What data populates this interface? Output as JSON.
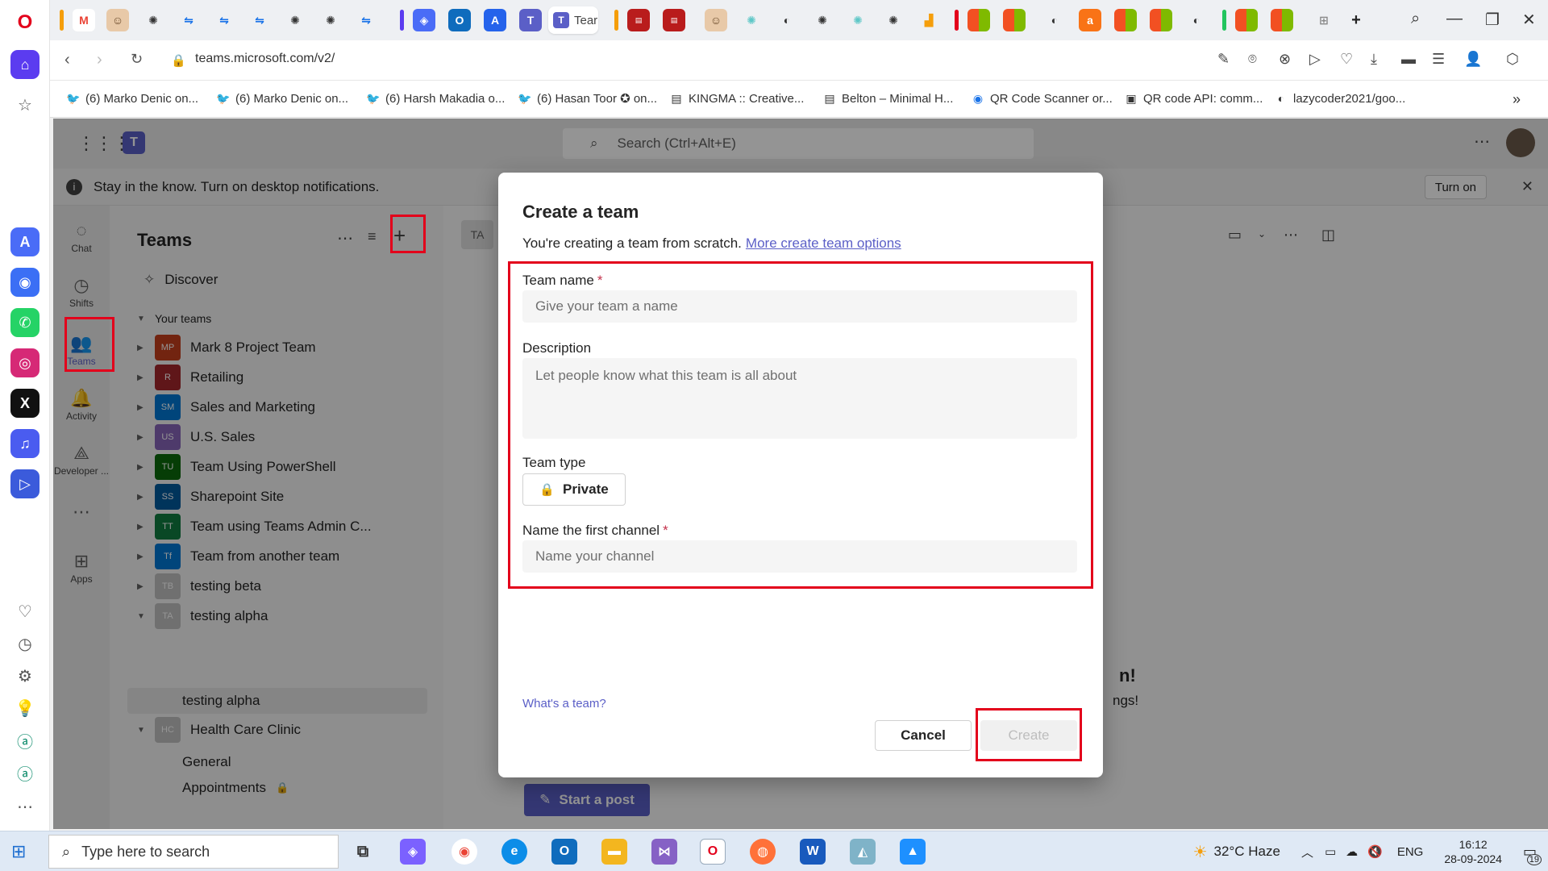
{
  "browser": {
    "url": "teams.microsoft.com/v2/",
    "active_tab_label": "Tear",
    "bookmarks": [
      "(6) Marko Denic on...",
      "(6) Marko Denic on...",
      "(6) Harsh Makadia o...",
      "(6) Hasan Toor ✪ on...",
      "KINGMA :: Creative...",
      "Belton – Minimal H...",
      "QR Code Scanner or...",
      "QR code API: comm...",
      "lazycoder2021/goo..."
    ]
  },
  "teams": {
    "search_placeholder": "Search (Ctrl+Alt+E)",
    "notification_text": "Stay in the know. Turn on desktop notifications.",
    "turn_on_label": "Turn on",
    "rail": {
      "chat": "Chat",
      "shifts": "Shifts",
      "teams": "Teams",
      "activity": "Activity",
      "developer": "Developer ...",
      "apps": "Apps"
    },
    "panel_title": "Teams",
    "discover_label": "Discover",
    "your_teams_label": "Your teams",
    "list": [
      {
        "initials": "MP",
        "name": "Mark 8 Project Team",
        "color": "#c43e1c"
      },
      {
        "initials": "R",
        "name": "Retailing",
        "color": "#a4262c"
      },
      {
        "initials": "SM",
        "name": "Sales and Marketing",
        "color": "#0078d4"
      },
      {
        "initials": "US",
        "name": "U.S. Sales",
        "color": "#8764b8"
      },
      {
        "initials": "TU",
        "name": "Team Using PowerShell",
        "color": "#0b6a0b"
      },
      {
        "initials": "SS",
        "name": "Sharepoint Site",
        "color": "#005a9e"
      },
      {
        "initials": "TT",
        "name": "Team using Teams Admin C...",
        "color": "#107c41"
      },
      {
        "initials": "Tf",
        "name": "Team from another team",
        "color": "#0078d4"
      },
      {
        "initials": "TB",
        "name": "testing beta",
        "color": "#c2c2c2"
      },
      {
        "initials": "TA",
        "name": "testing alpha",
        "color": "#c2c2c2"
      }
    ],
    "channel_testing_alpha": "testing alpha",
    "health_care": {
      "initials": "HC",
      "name": "Health Care Clinic"
    },
    "channel_general": "General",
    "channel_appointments": "Appointments",
    "header_badge": "TA",
    "start_post": "Start a post",
    "partial_heading": "n!",
    "partial_text": "ngs!"
  },
  "dialog": {
    "title": "Create a team",
    "subtitle": "You're creating a team from scratch.",
    "more_options_link": "More create team options",
    "team_name_label": "Team name",
    "team_name_placeholder": "Give your team a name",
    "description_label": "Description",
    "description_placeholder": "Let people know what this team is all about",
    "team_type_label": "Team type",
    "team_type_value": "Private",
    "channel_label": "Name the first channel",
    "channel_placeholder": "Name your channel",
    "required_mark": "*",
    "whats_team_link": "What's a team?",
    "cancel_label": "Cancel",
    "create_label": "Create"
  },
  "taskbar": {
    "search_placeholder": "Type here to search",
    "weather": "32°C  Haze",
    "language": "ENG",
    "time": "16:12",
    "date": "28-09-2024",
    "notification_count": "19"
  },
  "colors": {
    "teams_accent": "#5b5fc7",
    "highlight_red": "#e3001b",
    "required_red": "#c4314b"
  }
}
